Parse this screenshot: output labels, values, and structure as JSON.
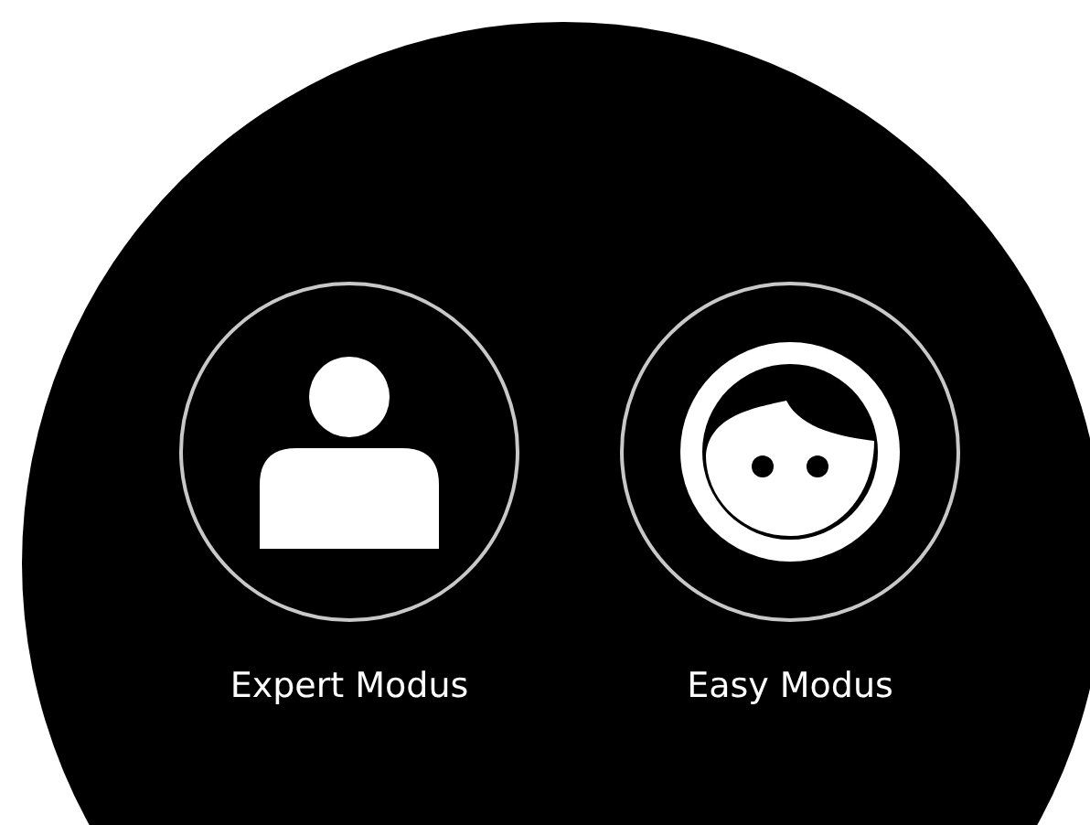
{
  "modes": [
    {
      "label": "Expert Modus",
      "kind": "person"
    },
    {
      "label": "Easy Modus",
      "kind": "face"
    }
  ]
}
